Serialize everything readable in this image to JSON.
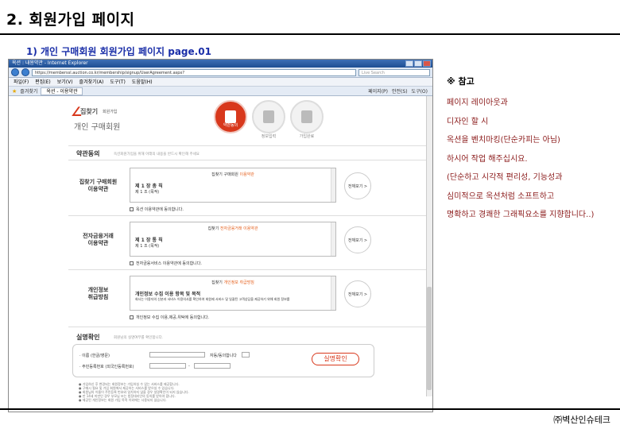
{
  "doc": {
    "title": "2. 회원가입 페이지",
    "subtitle": "1) 개인 구매회원  회원가입 페이지  page.01",
    "company": "㈜벽산인슈테크"
  },
  "browser": {
    "window_title": "옥션 : 내용약관 - Internet Explorer",
    "url": "https://memberssl.auction.co.kr/membership/signup/UserAgreement.aspx?",
    "search_placeholder": "Live Search",
    "menu": [
      "파일(F)",
      "편집(E)",
      "보기(V)",
      "즐겨찾기(A)",
      "도구(T)",
      "도움말(H)"
    ],
    "favorites_label": "즐겨찾기",
    "tab_label": "옥션 - 이용약관",
    "tools": [
      "페이지(P)",
      "안전(S)",
      "도구(O)"
    ]
  },
  "site": {
    "logo_text": "집찾기",
    "logo_sub": "회원가입",
    "page_title": "개인 구매회원",
    "steps": [
      {
        "label": "약관동의",
        "active": true
      },
      {
        "label": "정보입력",
        "active": false
      },
      {
        "label": "가입완료",
        "active": false
      }
    ],
    "agree_section": {
      "title": "약관동의",
      "desc": "옥션회원가입을 위해 아래의 내용을 반드시 확인해 주세요"
    },
    "terms": [
      {
        "label": "집찾기 구매회원\n이용약관",
        "box_title": "집찾기 구매회원",
        "box_title_hl": "이용약관",
        "chapter": "제 1 장  총 칙",
        "article": "제 1 조 (목적)",
        "view_all": "전체보기 >",
        "agree": "옥션 이용약관에 동의합니다."
      },
      {
        "label": "전자금융거래\n이용약관",
        "box_title": "집찾기",
        "box_title_hl": "전자금융거래 이용약관",
        "chapter": "제 1 장  통 칙",
        "article": "제 1 조 (목적)",
        "view_all": "전체보기 >",
        "agree": "전자금융서비스 이용약관에 동의합니다."
      },
      {
        "label": "개인정보\n취급방침",
        "box_title": "집찾기",
        "box_title_hl": "개인정보 취급방침",
        "chapter": "개인정보 수집 이용 항목 및 목적",
        "article": "회사는 이용자의 신분과 서비스 이용의사를 확인하여 회원제 서비스 및 일괄된 고객상담을 제공하기 위해 회원 정보를",
        "view_all": "전체보기 >",
        "agree": "개인정보 수집 이용,제공,위탁에 동의합니다."
      }
    ],
    "verify": {
      "title": "실명확인",
      "desc": "회원님의 실명여부를 확인합니다.",
      "name_label": "· 이름 (한글/영문)",
      "name_hint": "자동/동의합니다",
      "rrn_label": "· 주민등록번호 (외국인등록번호)",
      "button": "실명확인"
    },
    "notes": [
      "가입하신 후 변경되는 회원정보는 가입하실 수 있는 서비스를 제공합니다.",
      "구매시 필요 및 가입 회원에서 제공하는 서비스를 받으실 수 있습니다.",
      "회원님의 이름이 주민등록 번호와 일치하지 않을 경우 실명확인이 되지 않습니다.",
      "만 14세 미만인 경우 부모님 또는 법정대리인의 동의를 받아야 합니다.",
      "제공된 개인정보는 회원 가입 목적 이외에는 사용되지 않습니다."
    ]
  },
  "notes_panel": {
    "heading": "※ 참고",
    "lines": [
      "페이지 레이아웃과",
      "디자인 할 시",
      "옥션을 벤치마킹(단순카피는 아님)",
      "하시어 작업 해주십시요.",
      "(단순하고 시각적 편리성, 기능성과",
      "심미적으로 옥션처럼 소프트하고",
      "명확하고 경쾌한 그래픽요소를 지향합니다..)"
    ]
  }
}
